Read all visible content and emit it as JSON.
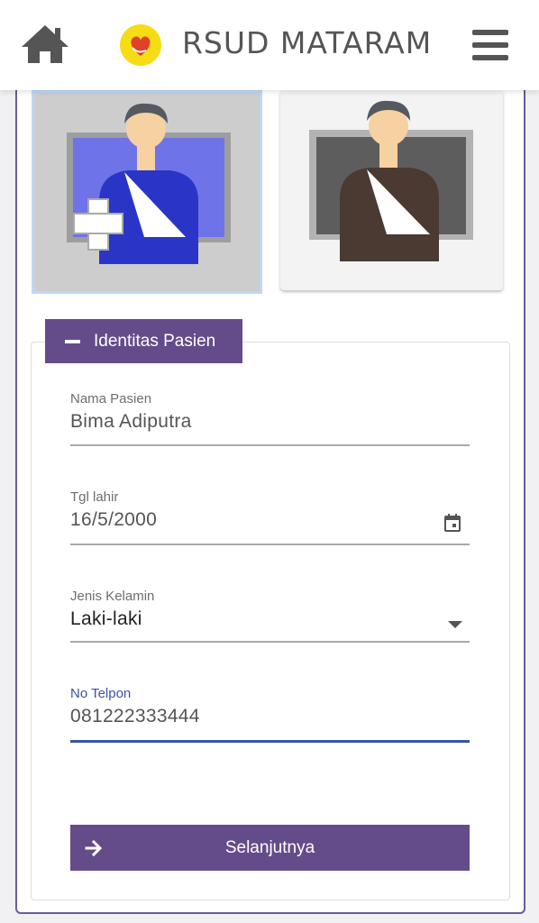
{
  "header": {
    "title": "RSUD MATARAM",
    "home_icon": "home-icon",
    "logo_icon": "hospital-logo-icon",
    "menu_icon": "hamburger-menu-icon"
  },
  "patient_types": [
    {
      "icon": "injured-patient-blue-icon",
      "selected": true
    },
    {
      "icon": "injured-patient-dark-icon",
      "selected": false
    }
  ],
  "panel": {
    "title": "Identitas Pasien",
    "collapse_icon": "minus-icon"
  },
  "form": {
    "name_label": "Nama Pasien",
    "name_value": "Bima Adiputra",
    "dob_label": "Tgl lahir",
    "dob_value": "16/5/2000",
    "gender_label": "Jenis Kelamin",
    "gender_value": "Laki-laki",
    "phone_label": "No Telpon",
    "phone_value": "081222333444"
  },
  "actions": {
    "next_label": "Selanjutnya",
    "next_icon": "arrow-right-icon"
  },
  "colors": {
    "primary": "#644c8a",
    "active_field": "#3b52a6",
    "selected_border": "#bcd8f6"
  }
}
